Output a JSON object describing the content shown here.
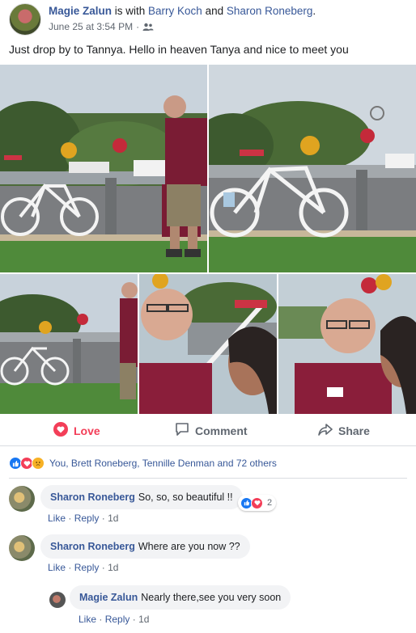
{
  "post": {
    "author": "Magie Zalun",
    "with_text": " is with ",
    "tag1": "Barry Koch",
    "and_text": " and ",
    "tag2": "Sharon Roneberg",
    "period": ".",
    "timestamp": "June 25 at 3:54 PM",
    "dot": "·",
    "privacy_icon": "friends-icon",
    "text": "Just drop by to Tannya. Hello in heaven Tanya and nice to meet you"
  },
  "actions": {
    "love_label": "Love",
    "comment_label": "Comment",
    "share_label": "Share"
  },
  "reactions": {
    "summary": "You, Brett Roneberg, Tennille Denman and 72 others",
    "types": [
      "like-icon",
      "love-icon",
      "sad-icon"
    ]
  },
  "comments": [
    {
      "author": "Sharon Roneberg",
      "text": "So, so, so beautiful !!",
      "reaction_count": "2",
      "like": "Like",
      "reply": "Reply",
      "sep": "·",
      "time": "1d"
    },
    {
      "author": "Sharon Roneberg",
      "text": "Where are you now ??",
      "like": "Like",
      "reply": "Reply",
      "sep": "·",
      "time": "1d"
    },
    {
      "author": "Magie Zalun",
      "text": "Nearly there,see you very soon",
      "like": "Like",
      "reply": "Reply",
      "sep": "·",
      "time": "1d"
    }
  ],
  "colors": {
    "link": "#385898",
    "love": "#f33e58",
    "like": "#1877f2",
    "muted": "#606770",
    "bubble": "#f2f3f5"
  }
}
